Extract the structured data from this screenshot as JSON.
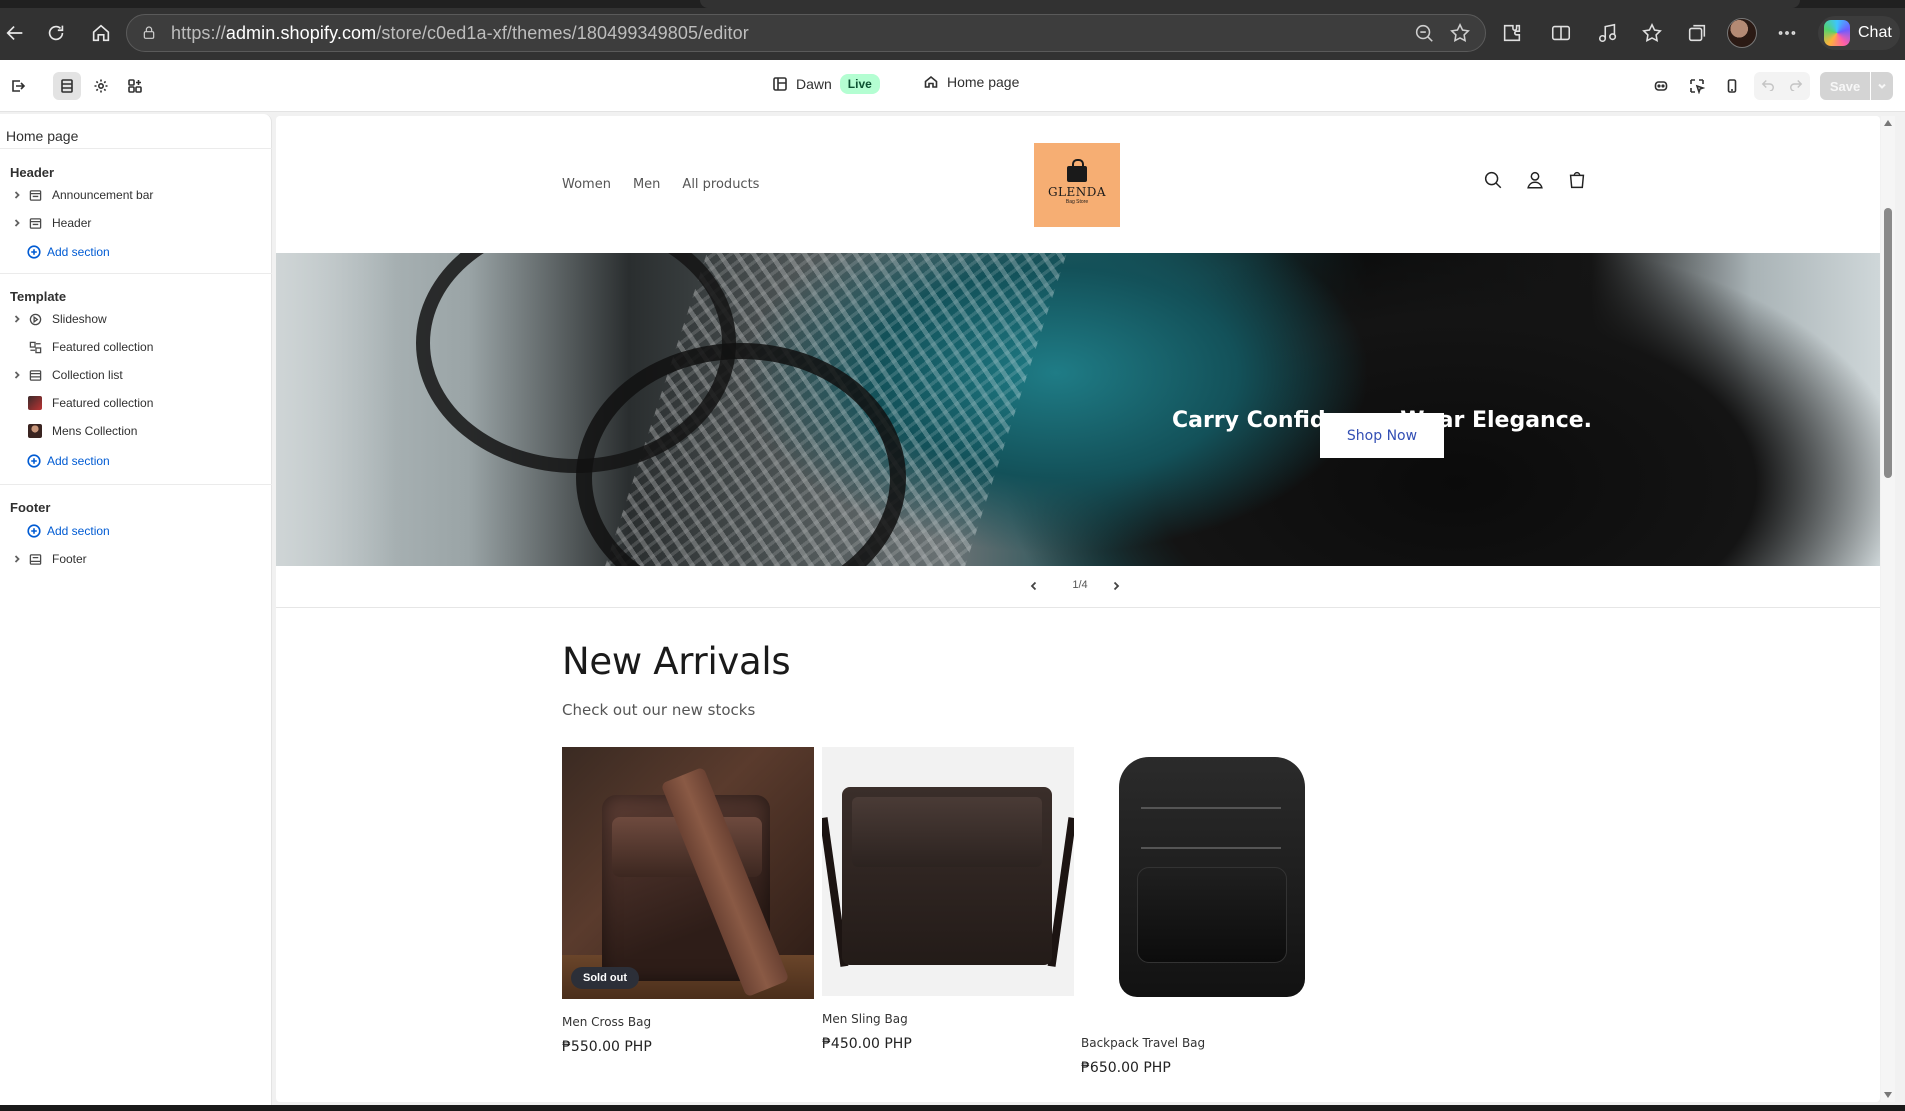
{
  "browser": {
    "url_prefix": "https://",
    "url_domain": "admin.shopify.com",
    "url_path": "/store/c0ed1a-xf/themes/180499349805/editor",
    "chat_label": "Chat"
  },
  "topbar": {
    "theme_name": "Dawn",
    "live_badge": "Live",
    "page_name": "Home page",
    "save_label": "Save"
  },
  "sidebar": {
    "title": "Home page",
    "groups": [
      {
        "label": "Header",
        "items": [
          {
            "label": "Announcement bar",
            "expandable": true,
            "icon": "layout-section-icon"
          },
          {
            "label": "Header",
            "expandable": true,
            "icon": "layout-section-icon"
          }
        ],
        "add_label": "Add section"
      },
      {
        "label": "Template",
        "items": [
          {
            "label": "Slideshow",
            "expandable": true,
            "icon": "slideshow-icon"
          },
          {
            "label": "Featured collection",
            "expandable": false,
            "icon": "image-collection-icon"
          },
          {
            "label": "Collection list",
            "expandable": true,
            "icon": "layout-section-icon"
          },
          {
            "label": "Featured collection",
            "expandable": false,
            "icon": "image-thumbnail-icon"
          },
          {
            "label": "Mens Collection",
            "expandable": false,
            "icon": "image-thumbnail-icon"
          }
        ],
        "add_label": "Add section"
      },
      {
        "label": "Footer",
        "add_label": "Add section",
        "items": [
          {
            "label": "Footer",
            "expandable": true,
            "icon": "layout-section-icon"
          }
        ]
      }
    ]
  },
  "store": {
    "nav": [
      "Women",
      "Men",
      "All products"
    ],
    "logo_name": "GLENDA",
    "logo_sub": "Bag Store",
    "hero": {
      "heading": "Carry Confidence. Wear Elegance.",
      "button": "Shop Now"
    },
    "slider": {
      "counter": "1/4"
    },
    "collection": {
      "title": "New Arrivals",
      "subtitle": "Check out our new stocks",
      "products": [
        {
          "name": "Men Cross Bag",
          "price": "₱550.00 PHP",
          "badge": "Sold out"
        },
        {
          "name": "Men Sling Bag",
          "price": "₱450.00 PHP",
          "badge": ""
        },
        {
          "name": "Backpack Travel Bag",
          "price": "₱650.00 PHP",
          "badge": ""
        }
      ]
    }
  },
  "colors": {
    "accent_link": "#005bd3",
    "live_badge_bg": "#b4fed2",
    "logo_bg": "#f6ae73",
    "hero_button_text": "#334fb4"
  }
}
